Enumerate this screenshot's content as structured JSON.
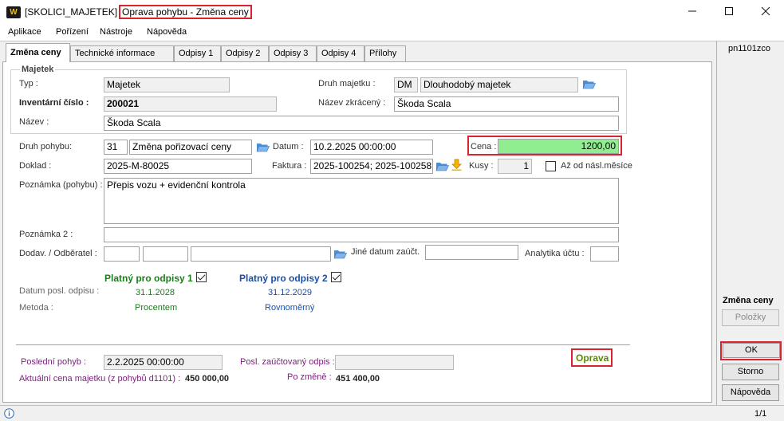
{
  "window": {
    "prefix": "[SKOLICI_MAJETEK]",
    "title": "Oprava pohybu - Změna ceny",
    "logo": "W"
  },
  "menu": [
    "Aplikace",
    "Pořízení",
    "Nástroje",
    "Nápověda"
  ],
  "tabs": [
    "Změna ceny",
    "Technické informace",
    "Odpisy 1",
    "Odpisy 2",
    "Odpisy 3",
    "Odpisy 4",
    "Přílohy"
  ],
  "majetek": {
    "group_label": "Majetek",
    "typ_label": "Typ :",
    "typ_value": "Majetek",
    "druh_label": "Druh majetku :",
    "druh_code": "DM",
    "druh_value": "Dlouhodobý majetek",
    "inv_label": "Inventární číslo :",
    "inv_value": "200021",
    "nazev_zkr_label": "Název zkrácený :",
    "nazev_zkr_value": "Škoda Scala",
    "nazev_label": "Název :",
    "nazev_value": "Škoda Scala"
  },
  "pohyb": {
    "druh_label": "Druh pohybu:",
    "druh_code": "31",
    "druh_value": "Změna pořizovací ceny",
    "datum_label": "Datum :",
    "datum_value": "10.2.2025 00:00:00",
    "cena_label": "Cena :",
    "cena_value": "1200,00",
    "doklad_label": "Doklad :",
    "doklad_value": "2025-M-80025",
    "faktura_label": "Faktura :",
    "faktura_value": "2025-100254; 2025-100258",
    "kusy_label": "Kusy :",
    "kusy_value": "1",
    "az_od_label": "Až od násl.měsíce",
    "poznamka_label": "Poznámka (pohybu) :",
    "poznamka_value": "Přepis vozu + evidenční kontrola",
    "poznamka2_label": "Poznámka 2 :",
    "poznamka2_value": "",
    "dodav_label": "Dodav. / Odběratel :",
    "jine_datum_label": "Jiné datum zaúčt.",
    "analytika_label": "Analytika účtu :"
  },
  "odpisy": {
    "platny1_label": "Platný pro odpisy 1",
    "platny2_label": "Platný pro odpisy 2",
    "datum_posl_label": "Datum posl. odpisu :",
    "datum1": "31.1.2028",
    "datum2": "31.12.2029",
    "metoda_label": "Metoda :",
    "metoda1": "Procentem",
    "metoda2": "Rovnoměrný"
  },
  "footer": {
    "posledni_label": "Poslední pohyb :",
    "posledni_value": "2.2.2025 00:00:00",
    "posl_zauct_label": "Posl. zaúčtovaný odpis :",
    "posl_zauct_value": "",
    "oprava_label": "Oprava",
    "aktualni_label": "Aktuální cena majetku  (z pohybů d1101)  :",
    "aktualni_value": "450 000,00",
    "po_zmene_label": "Po změně :",
    "po_zmene_value": "451 400,00"
  },
  "right_panel": {
    "code": "pn1101zco",
    "section_title": "Změna ceny",
    "polozky": "Položky",
    "ok": "OK",
    "storno": "Storno",
    "napoveda": "Nápověda"
  },
  "status": {
    "page": "1/1"
  },
  "colors": {
    "highlight_red": "#d9232e",
    "cena_green": "#90ee90",
    "odpisy1_green": "#1a7d1a",
    "odpisy2_blue": "#1a4fa8",
    "purple_label": "#7a1f7a"
  }
}
